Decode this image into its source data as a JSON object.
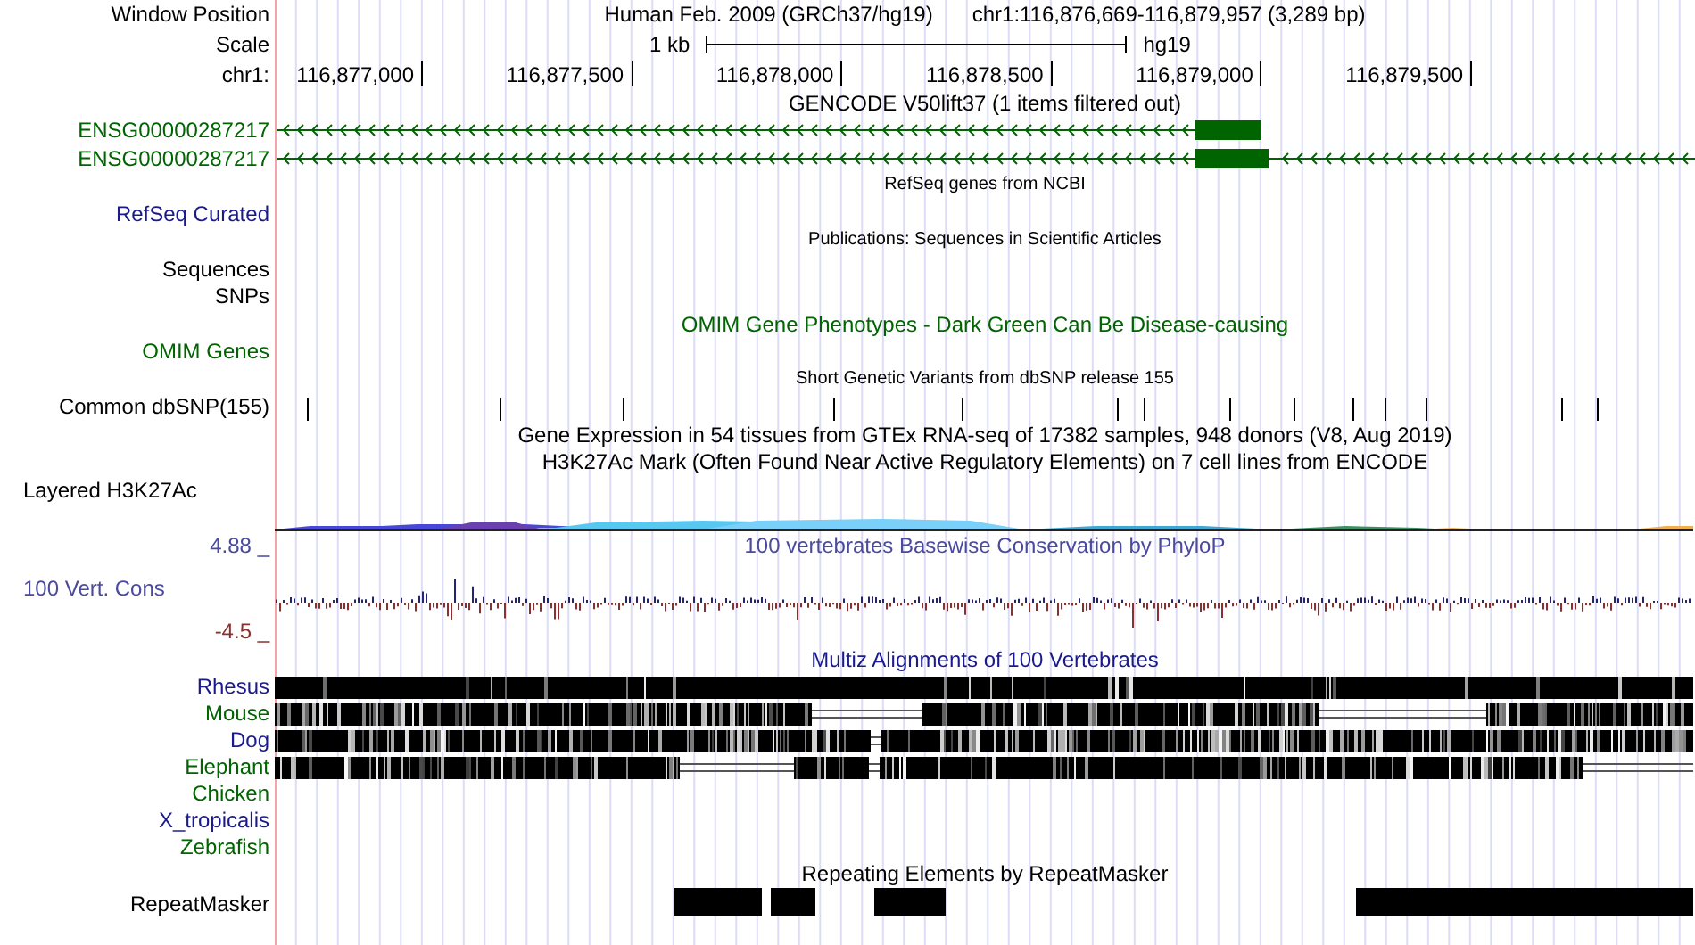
{
  "header": {
    "label": "Window Position",
    "title": "Human Feb. 2009 (GRCh37/hg19)",
    "position": "chr1:116,876,669-116,879,957 (3,289 bp)"
  },
  "scale": {
    "label": "Scale",
    "bar_label": "1 kb",
    "assembly": "hg19"
  },
  "ruler": {
    "label": "chr1:",
    "ticks": [
      "116,877,000",
      "116,877,500",
      "116,878,000",
      "116,878,500",
      "116,879,000",
      "116,879,500"
    ]
  },
  "tracks": [
    {
      "kind": "title",
      "text": "GENCODE V50lift37 (1 items filtered out)",
      "color": "#000000"
    },
    {
      "kind": "gene",
      "label": "ENSG00000287217",
      "color": "#006400"
    },
    {
      "kind": "gene",
      "label": "ENSG00000287217",
      "color": "#006400"
    },
    {
      "kind": "note",
      "text": "RefSeq genes from NCBI",
      "color": "#000000"
    },
    {
      "kind": "label",
      "label": "RefSeq Curated",
      "color": "#1a1a8c"
    },
    {
      "kind": "note",
      "text": "Publications: Sequences in Scientific Articles",
      "color": "#000000"
    },
    {
      "kind": "label",
      "label": "Sequences",
      "color": "#000000"
    },
    {
      "kind": "label",
      "label": "SNPs",
      "color": "#000000"
    },
    {
      "kind": "title",
      "text": "OMIM Gene Phenotypes - Dark Green Can Be Disease-causing",
      "color": "#006400"
    },
    {
      "kind": "label",
      "label": "OMIM Genes",
      "color": "#006400"
    },
    {
      "kind": "note",
      "text": "Short Genetic Variants from dbSNP release 155",
      "color": "#000000"
    },
    {
      "kind": "snp",
      "label": "Common dbSNP(155)",
      "color": "#000000"
    },
    {
      "kind": "title",
      "text": "Gene Expression in 54 tissues from GTEx RNA-seq of 17382 samples, 948 donors (V8, Aug 2019)",
      "color": "#000000"
    },
    {
      "kind": "title",
      "text": "H3K27Ac Mark (Often Found Near Active Regulatory Elements) on 7 cell lines from ENCODE",
      "color": "#000000"
    },
    {
      "kind": "layered",
      "label": "Layered H3K27Ac",
      "color": "#000000"
    },
    {
      "kind": "conservation",
      "title": "100 vertebrates Basewise Conservation by PhyloP",
      "label": "100 Vert. Cons",
      "max": "4.88 _",
      "min": "-4.5 _",
      "color": "#4a4a9e"
    },
    {
      "kind": "title",
      "text": "Multiz Alignments of 100 Vertebrates",
      "color": "#1a1a8c"
    },
    {
      "kind": "alignment",
      "label": "Rhesus",
      "color": "#1a1a8c"
    },
    {
      "kind": "alignment",
      "label": "Mouse",
      "color": "#006400"
    },
    {
      "kind": "alignment",
      "label": "Dog",
      "color": "#1a1a8c"
    },
    {
      "kind": "alignment",
      "label": "Elephant",
      "color": "#006400"
    },
    {
      "kind": "alignment",
      "label": "Chicken",
      "color": "#006400"
    },
    {
      "kind": "alignment",
      "label": "X_tropicalis",
      "color": "#1a1a8c"
    },
    {
      "kind": "alignment",
      "label": "Zebrafish",
      "color": "#006400"
    },
    {
      "kind": "title",
      "text": "Repeating Elements by RepeatMasker",
      "color": "#000000"
    },
    {
      "kind": "repeat",
      "label": "RepeatMasker",
      "color": "#000000"
    }
  ]
}
